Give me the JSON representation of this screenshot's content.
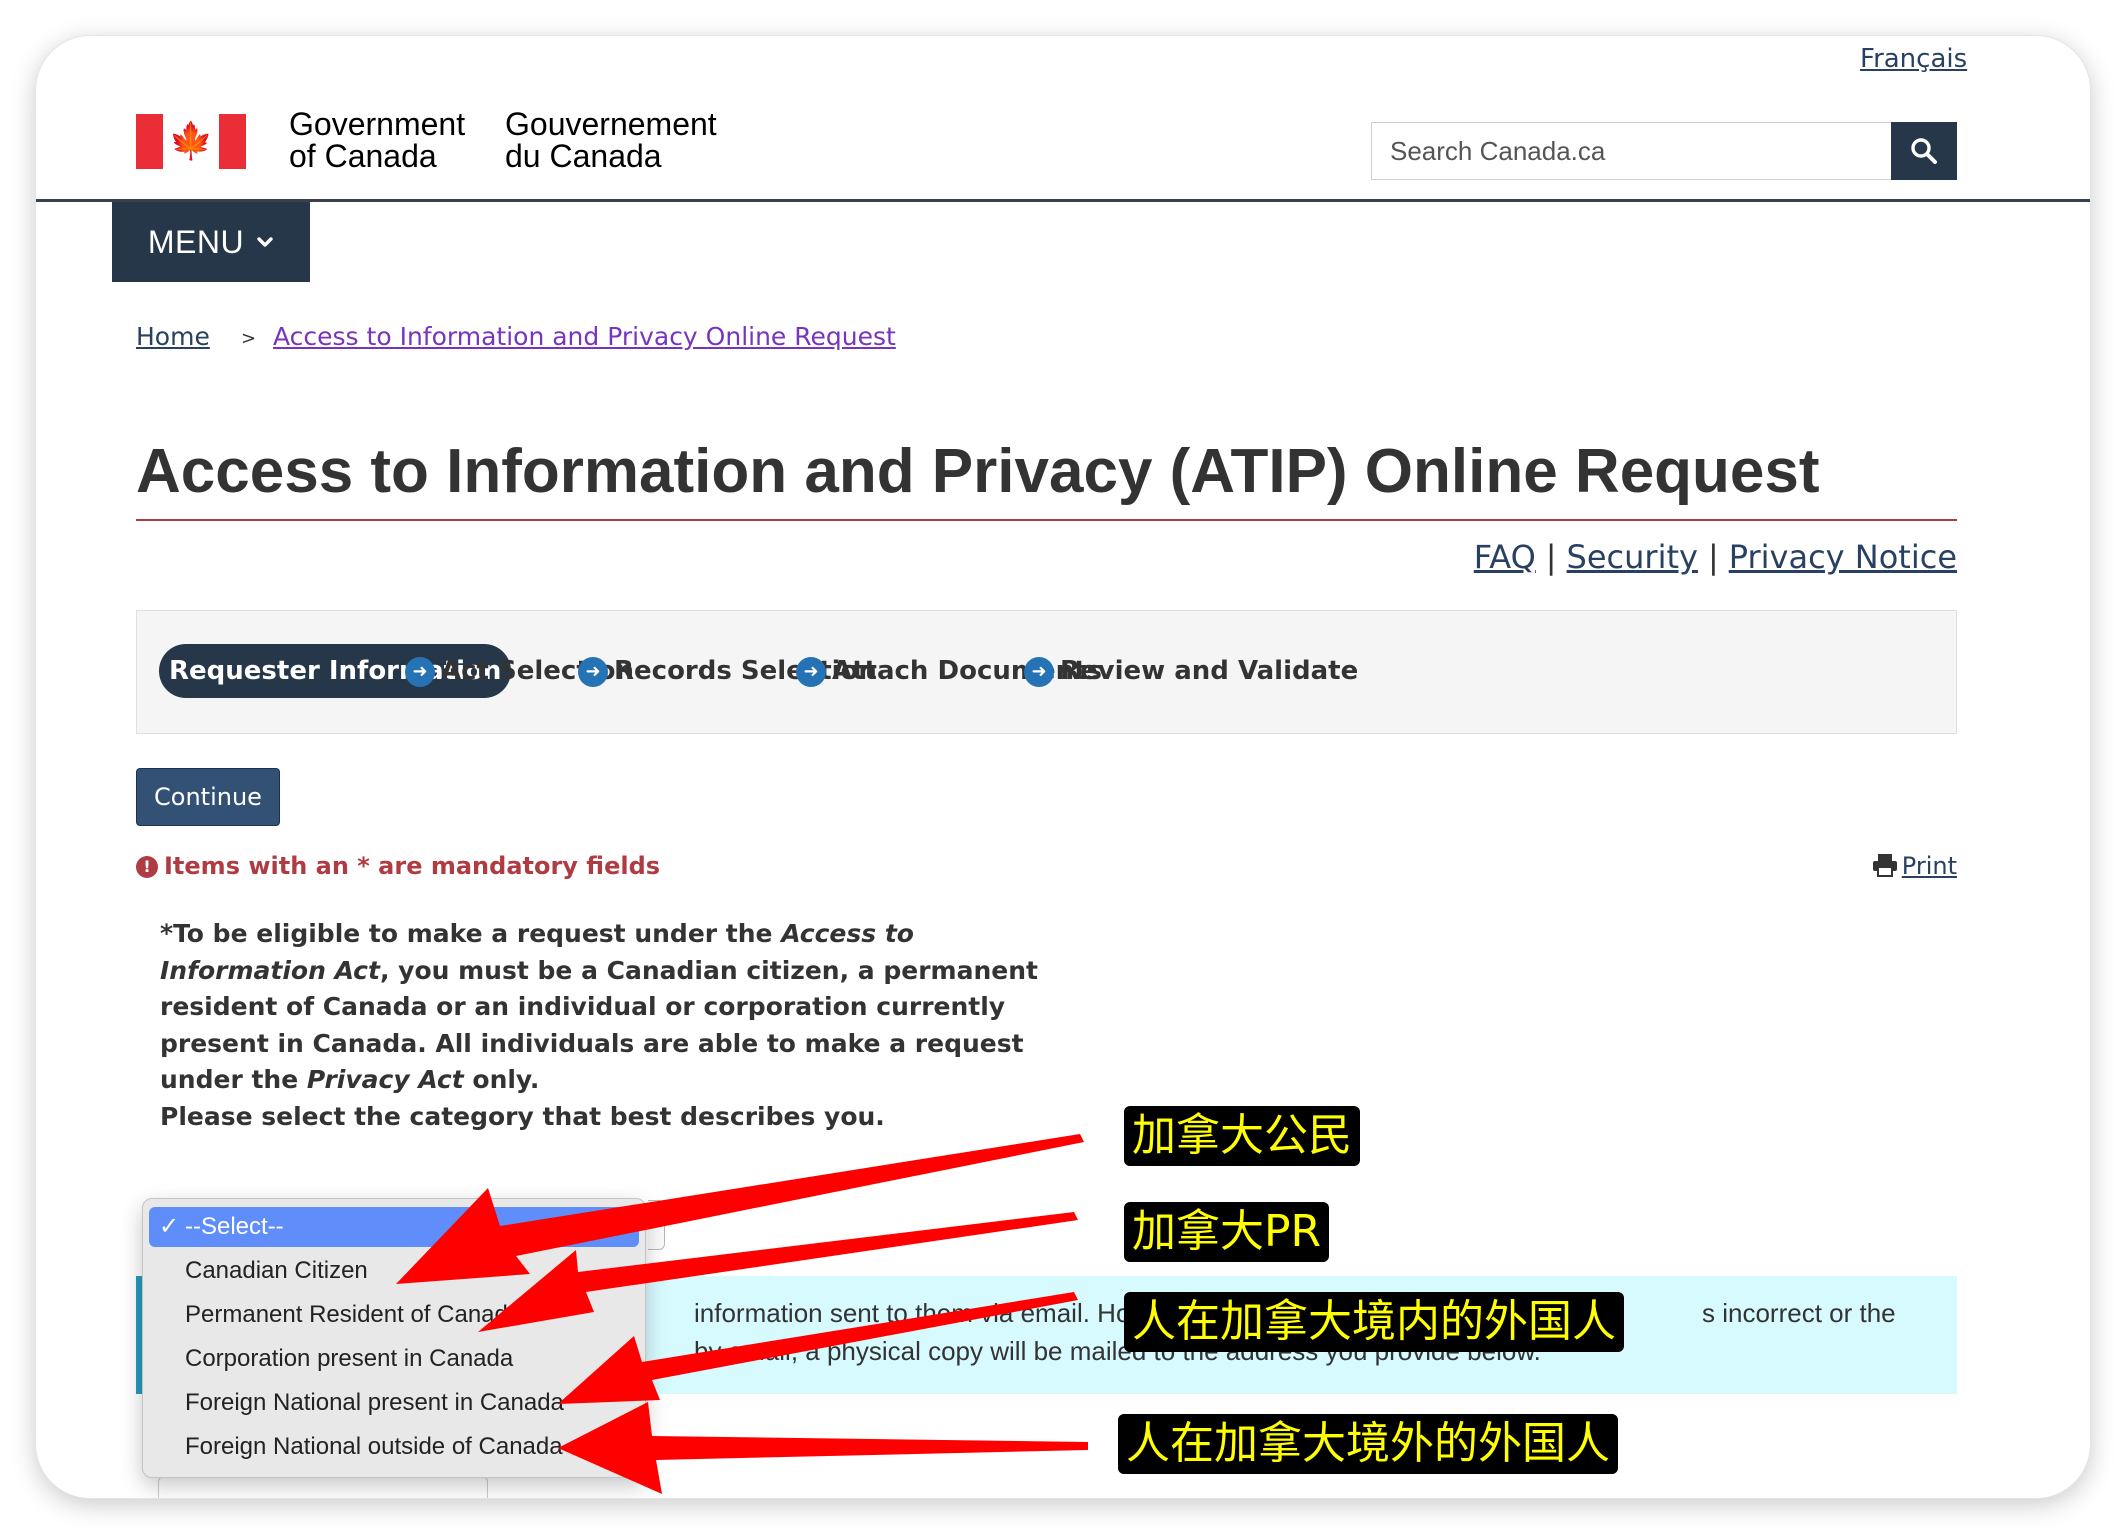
{
  "header": {
    "language_link": "Français",
    "signature_en_line1": "Government",
    "signature_en_line2": "of Canada",
    "signature_fr_line1": "Gouvernement",
    "signature_fr_line2": "du Canada",
    "flag_icon": "maple-leaf-icon",
    "search": {
      "placeholder": "Search Canada.ca",
      "button_icon": "search-icon"
    },
    "menu_label": "MENU",
    "menu_icon": "chevron-down-icon"
  },
  "breadcrumb": {
    "home": "Home",
    "separator": ">",
    "current": "Access to Information and Privacy Online Request"
  },
  "page": {
    "title": "Access to Information and Privacy (ATIP) Online Request",
    "help_links": {
      "faq": "FAQ",
      "security": "Security",
      "privacy": "Privacy Notice",
      "separator": "|"
    }
  },
  "steps": {
    "items": [
      {
        "label": "Requester Information",
        "active": true
      },
      {
        "label": "Act Selection",
        "active": false
      },
      {
        "label": "Records Selection",
        "active": false
      },
      {
        "label": "Attach Documents",
        "active": false
      },
      {
        "label": "Review and Validate",
        "active": false
      }
    ],
    "arrow_icon": "arrow-right-circle-icon"
  },
  "form": {
    "continue_label": "Continue",
    "mandatory_note": "Items with an * are mandatory fields",
    "mandatory_icon": "exclamation-circle-icon",
    "print_label": "Print",
    "print_icon": "printer-icon",
    "eligibility": {
      "part1": "*To be eligible to make a request under the ",
      "access_act": "Access to Information Act",
      "part2": ", you must be a Canadian citizen, a permanent resident of Canada or an individual or corporation currently present in Canada. All individuals are able to make a request under the ",
      "privacy_act": "Privacy Act",
      "part3": " only.",
      "instruction": "Please select the category that best describes you."
    },
    "info_box": {
      "line1_left": "information sent to them via email. Ho",
      "line1_right": "s incorrect or the",
      "line2_left": "by email, a physical copy will be mailed to the address you provide below."
    },
    "category_select": {
      "selected": "--Select--",
      "options": [
        "--Select--",
        "Canadian Citizen",
        "Permanent Resident of Canada",
        "Corporation present in Canada",
        "Foreign National present in Canada",
        "Foreign National outside of Canada"
      ]
    }
  },
  "annotations": {
    "arrow_color": "#ff0000",
    "label_text_color": "#ffff00",
    "label_bg_color": "#000000",
    "labels": [
      {
        "text": "加拿大公民",
        "points_to": "Canadian Citizen"
      },
      {
        "text": "加拿大PR",
        "points_to": "Permanent Resident of Canada"
      },
      {
        "text": "人在加拿大境内的外国人",
        "points_to": "Foreign National present in Canada"
      },
      {
        "text": "人在加拿大境外的外国人",
        "points_to": "Foreign National outside of Canada"
      }
    ]
  },
  "colors": {
    "brand_navy": "#26374a",
    "link_blue": "#284162",
    "visited_purple": "#7834bc",
    "accent_red": "#af3c43",
    "flag_red": "#eb2d37",
    "info_bg": "#d7faff",
    "select_highlight": "#5f8dfa"
  }
}
